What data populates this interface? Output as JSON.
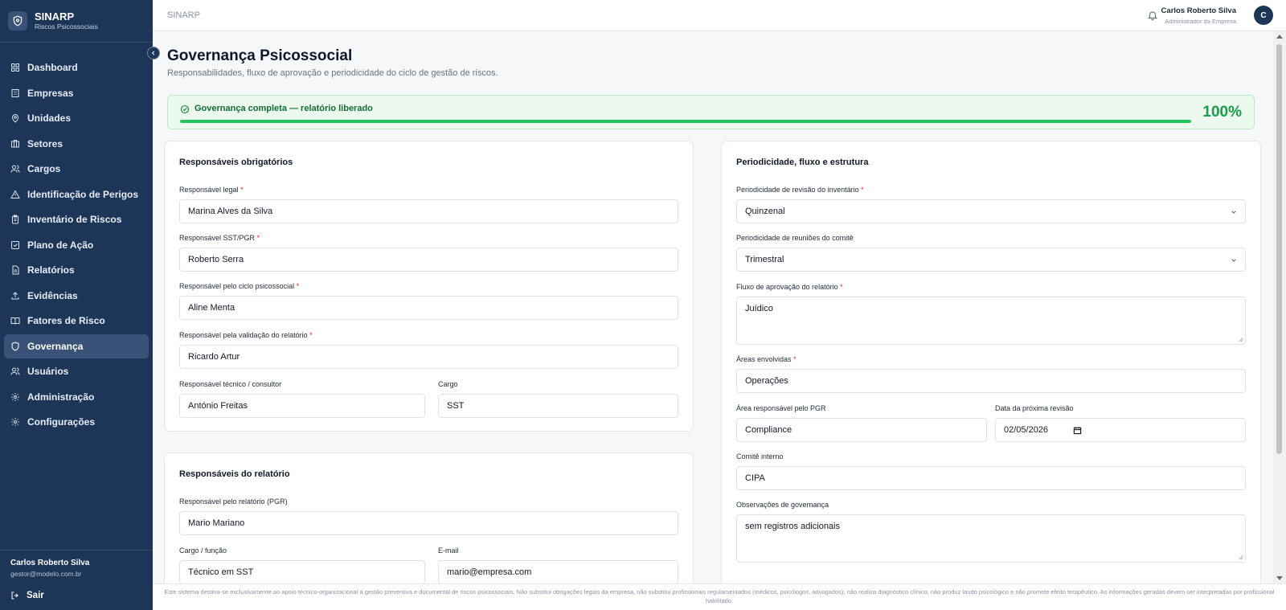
{
  "app": {
    "name": "SINARP",
    "subtitle": "Riscos Psicossociais"
  },
  "sidebar": {
    "items": [
      {
        "label": "Dashboard",
        "icon": "grid-icon"
      },
      {
        "label": "Empresas",
        "icon": "building-icon"
      },
      {
        "label": "Unidades",
        "icon": "map-pin-icon"
      },
      {
        "label": "Setores",
        "icon": "columns-icon"
      },
      {
        "label": "Cargos",
        "icon": "users-icon"
      },
      {
        "label": "Identificação de Perigos",
        "icon": "warning-icon"
      },
      {
        "label": "Inventário de Riscos",
        "icon": "clipboard-icon"
      },
      {
        "label": "Plano de Ação",
        "icon": "check-square-icon"
      },
      {
        "label": "Relatórios",
        "icon": "file-text-icon"
      },
      {
        "label": "Evidências",
        "icon": "upload-icon"
      },
      {
        "label": "Fatores de Risco",
        "icon": "book-icon"
      },
      {
        "label": "Governança",
        "icon": "shield-icon",
        "active": true
      },
      {
        "label": "Usuários",
        "icon": "users-icon"
      },
      {
        "label": "Administração",
        "icon": "gear-icon"
      },
      {
        "label": "Configurações",
        "icon": "gear-icon"
      }
    ],
    "user_name": "Carlos Roberto Silva",
    "user_email": "gestor@modelo.com.br",
    "logout_label": "Sair"
  },
  "header": {
    "title": "SINARP",
    "user_name": "Carlos Roberto Silva",
    "user_role": "Administrador da Empresa",
    "avatar_initial": "C"
  },
  "page": {
    "title": "Governança Psicossocial",
    "subtitle": "Responsabilidades, fluxo de aprovação e periodicidade do ciclo de gestão de riscos."
  },
  "status": {
    "text": "Governança completa — relatório liberado",
    "percent_label": "100%",
    "progress": 1.0,
    "color": "#22c55e"
  },
  "card_responsaveis": {
    "title": "Responsáveis obrigatórios",
    "legal_label": "Responsável legal",
    "legal_value": "Marina Alves da Silva",
    "sst_label": "Responsável SST/PGR",
    "sst_value": "Roberto Serra",
    "ciclo_label": "Responsável pelo ciclo psicossocial",
    "ciclo_value": "Aline Menta",
    "validacao_label": "Responsável pela validação do relatório",
    "validacao_value": "Ricardo Artur",
    "tecnico_label": "Responsável técnico / consultor",
    "tecnico_value": "António Freitas",
    "cargo_label": "Cargo",
    "cargo_value": "SST"
  },
  "card_relatorio": {
    "title": "Responsáveis do relatório",
    "pgr_label": "Responsável pelo relatório (PGR)",
    "pgr_value": "Mario Mariano",
    "funcao_label": "Cargo / função",
    "funcao_value": "Técnico em SST",
    "email_label": "E-mail",
    "email_value": "mario@empresa.com"
  },
  "card_periodicidade": {
    "title": "Periodicidade, fluxo e estrutura",
    "inventario_label": "Periodicidade de revisão do inventário",
    "inventario_value": "Quinzenal",
    "reunioes_label": "Periodicidade de reuniões do comitê",
    "reunioes_value": "Trimestral",
    "fluxo_label": "Fluxo de aprovação do relatório",
    "fluxo_value": "Juídico",
    "areas_label": "Áreas envolvidas",
    "areas_value": "Operações",
    "area_pgr_label": "Área responsável pelo PGR",
    "area_pgr_value": "Compliance",
    "data_label": "Data da próxima revisão",
    "data_value": "02/05/2026",
    "comite_label": "Comitê interno",
    "comite_value": "CIPA",
    "obs_label": "Observações de governança",
    "obs_value": "sem registros adicionais"
  },
  "footer": {
    "disclaimer": "Este sistema destina-se exclusivamente ao apoio técnico-organizacional à gestão preventiva e documental de riscos psicossociais. Não substitui obrigações legais da empresa, não substitui profissionais regulamentados (médicos, psicólogos, advogados), não realiza diagnóstico clínico, não produz laudo psicológico e não promete efeito terapêutico. As informações geradas devem ser interpretadas por profissional habilitado."
  },
  "required_mark": "*"
}
